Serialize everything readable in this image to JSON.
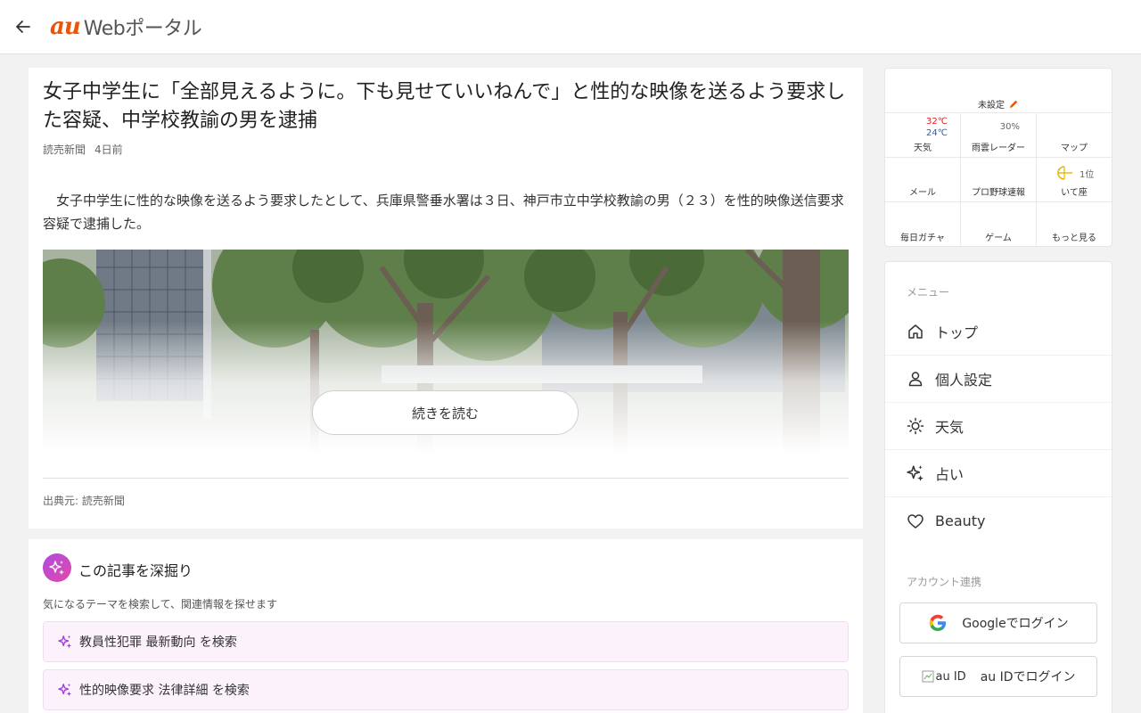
{
  "header": {
    "logo_brand": "au",
    "logo_text": "Webポータル"
  },
  "article": {
    "title": "女子中学生に「全部見えるように。下も見せていいねんで」と性的な映像を送るよう要求した容疑、中学校教諭の男を逮捕",
    "publisher": "読売新聞",
    "age": "4日前",
    "body": "　女子中学生に性的な映像を送るよう要求したとして、兵庫県警垂水署は３日、神戸市立中学校教諭の男（２３）を性的映像送信要求容疑で逮捕した。",
    "read_more": "続きを読む",
    "source": "出典元: 読売新聞"
  },
  "deepdig": {
    "title": "この記事を深掘り",
    "subtitle": "気になるテーマを検索して、関連情報を探せます",
    "items": [
      "教員性犯罪 最新動向 を検索",
      "性的映像要求 法律詳細 を検索"
    ]
  },
  "widget": {
    "unset": "未設定",
    "weather": {
      "hi": "32℃",
      "lo": "24℃",
      "label": "天気"
    },
    "rain": {
      "value": "30%",
      "label": "雨雲レーダー"
    },
    "map": {
      "label": "マップ"
    },
    "mail": {
      "label": "メール"
    },
    "baseball": {
      "label": "プロ野球速報"
    },
    "horoscope": {
      "rank": "1位",
      "label": "いて座"
    },
    "gacha": {
      "label": "毎日ガチャ"
    },
    "game": {
      "label": "ゲーム"
    },
    "more": {
      "label": "もっと見る"
    }
  },
  "menu": {
    "heading": "メニュー",
    "items": [
      {
        "label": "トップ",
        "icon": "home-icon"
      },
      {
        "label": "個人設定",
        "icon": "person-icon"
      },
      {
        "label": "天気",
        "icon": "sun-icon"
      },
      {
        "label": "占い",
        "icon": "sparkle-icon"
      },
      {
        "label": "Beauty",
        "icon": "heart-icon"
      }
    ],
    "account_heading": "アカウント連携",
    "google_login": "Googleでログイン",
    "auid_alt": "au ID",
    "auid_login": "au IDでログイン"
  },
  "colors": {
    "brand": "#eb5505",
    "temp_high": "#e02020",
    "temp_low": "#1a5fd0",
    "deepdig_accent": "#b04ae0"
  }
}
